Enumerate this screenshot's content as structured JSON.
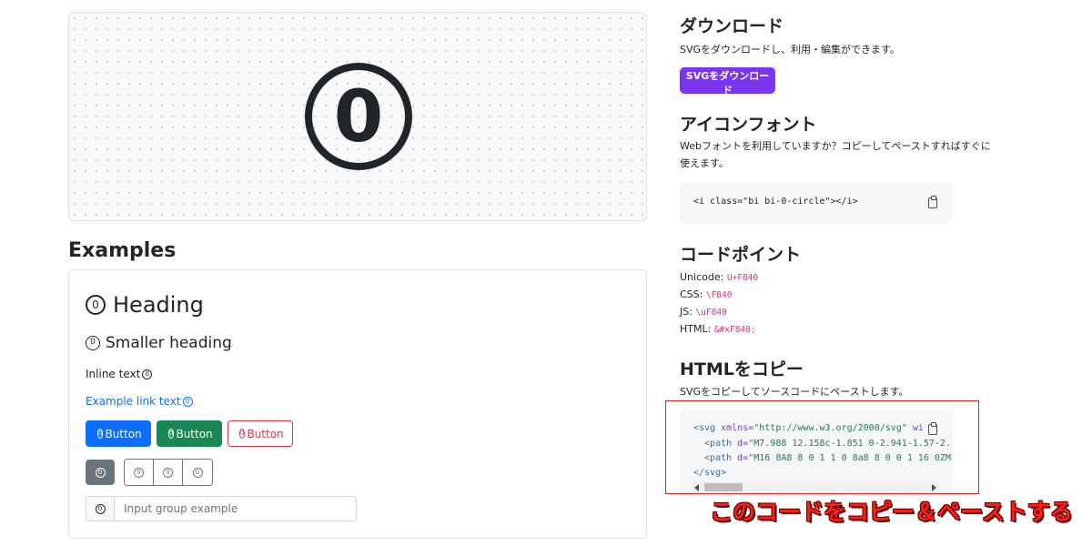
{
  "preview": {
    "icon": "0-circle-icon",
    "glyph": "0"
  },
  "examples": {
    "title": "Examples",
    "heading": "Heading",
    "smaller_heading": "Smaller heading",
    "inline_text": "Inline text",
    "link_text": "Example link text",
    "buttons": [
      {
        "label": "Button",
        "variant": "primary",
        "color": "#0d6efd"
      },
      {
        "label": "Button",
        "variant": "success",
        "color": "#198754"
      },
      {
        "label": "Button",
        "variant": "outline-danger",
        "color": "#dc3545"
      }
    ],
    "input_placeholder": "Input group example",
    "icon_glyph": "0"
  },
  "download": {
    "title": "ダウンロード",
    "desc": "SVGをダウンロードし、利用・編集ができます。",
    "button": "SVGをダウンロード",
    "button_color": "#7a35ee"
  },
  "icon_font": {
    "title": "アイコンフォント",
    "desc_line1": "Webフォントを利用していますか？コピーしてペーストすればすぐに",
    "desc_line2": "使えます。",
    "code": "<i class=\"bi bi-0-circle\"></i>"
  },
  "code_point": {
    "title": "コードポイント",
    "rows": [
      {
        "label": "Unicode:",
        "value": "U+F840"
      },
      {
        "label": "CSS:",
        "value": "\\F840"
      },
      {
        "label": "JS:",
        "value": "\\uF840"
      },
      {
        "label": "HTML:",
        "value": "&#xF840;"
      }
    ]
  },
  "copy_html": {
    "title": "HTMLをコピー",
    "desc": "SVGをコピーしてソースコードにペーストします。",
    "lines": {
      "l1_tag": "<svg",
      "l1_attr": " xmlns=",
      "l1_str": "\"http://www.w3.org/2000/svg\"",
      "l1_rest": " wid",
      "l2_tag": "  <path",
      "l2_attr": " d=",
      "l2_str": "\"M7.988 12.158c-1.851 0-2.941-1.57-2.",
      "l3_tag": "  <path",
      "l3_attr": " d=",
      "l3_str": "\"M16 8A8 8 0 1 1 0 8a8 8 0 0 1 16 0ZM",
      "l4_tag": "</svg>"
    }
  },
  "annotation": {
    "text": "このコードをコピー＆ペーストする",
    "color": "#ff1e14"
  }
}
